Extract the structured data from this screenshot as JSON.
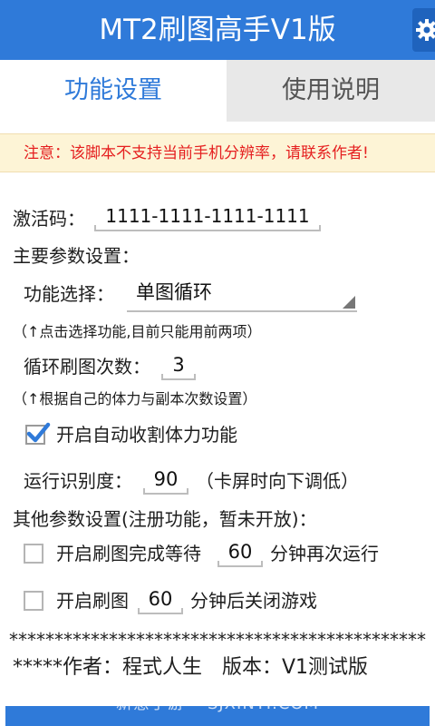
{
  "app": {
    "title": "MT2刷图高手V1版"
  },
  "tabs": [
    {
      "label": "功能设置",
      "active": true
    },
    {
      "label": "使用说明",
      "active": false
    }
  ],
  "warning": "注意：该脚本不支持当前手机分辨率，请联系作者!",
  "activation": {
    "label": "激活码：",
    "value": "1111-1111-1111-1111"
  },
  "main_settings_label": "主要参数设置：",
  "function_select": {
    "label": "功能选择：",
    "value": "单图循环",
    "hint": "（↑点击选择功能,目前只能用前两项）"
  },
  "loop_count": {
    "label": "循环刷图次数：",
    "value": "3",
    "hint": "（↑根据自己的体力与副本次数设置）"
  },
  "auto_harvest": {
    "label": "开启自动收割体力功能",
    "checked": true
  },
  "recognition": {
    "label": "运行识别度：",
    "value": "90",
    "note": "（卡屏时向下调低）"
  },
  "other_settings_label": "其他参数设置(注册功能，暂未开放)：",
  "wait_option": {
    "label_prefix": "开启刷图完成等待",
    "value": "60",
    "label_suffix": "分钟再次运行",
    "checked": false
  },
  "close_option": {
    "label_prefix": "开启刷图",
    "value": "60",
    "label_suffix": "分钟后关闭游戏",
    "checked": false
  },
  "separator": "**********************************************",
  "footer": "*****作者：程式人生　版本：V1测试版",
  "watermark": "新意手游 • SJXINYI.COM",
  "colors": {
    "primary": "#2f7ad9",
    "warning_text": "#e52020",
    "warning_bg": "#fdf4d6",
    "check": "#2f7ad9"
  },
  "icons": {
    "settings": "gear-icon",
    "dropdown": "dropdown-triangle-icon",
    "checkmark": "checkmark-icon"
  }
}
